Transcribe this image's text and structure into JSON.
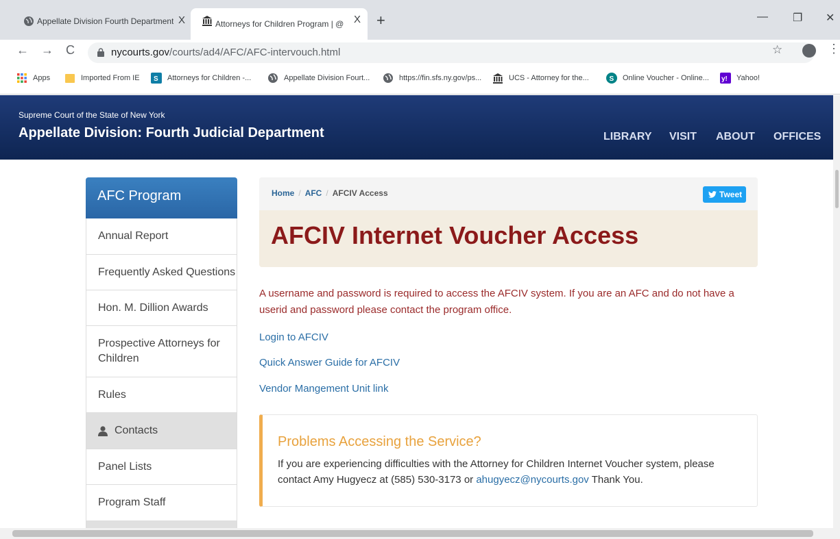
{
  "browser": {
    "tabs": [
      {
        "title": "Appellate Division Fourth Department",
        "close": "X"
      },
      {
        "title": "Attorneys for Children Program | @NYA",
        "close": "X"
      }
    ],
    "new_tab": "+",
    "window": {
      "minimize": "—",
      "maximize": "❐",
      "close": "✕"
    },
    "nav": {
      "back": "←",
      "forward": "→",
      "reload": "C"
    },
    "url_host": "nycourts.gov",
    "url_path": "/courts/ad4/AFC/AFC-intervouch.html",
    "star": "☆",
    "menu": "⋮",
    "bookmarks": [
      {
        "label": "Apps",
        "icon": "apps-grid-icon"
      },
      {
        "label": "Imported From IE",
        "icon": "folder-icon"
      },
      {
        "label": "Attorneys for Children -...",
        "icon": "sharepoint-icon"
      },
      {
        "label": "Appellate Division Fourt...",
        "icon": "globe-icon"
      },
      {
        "label": "https://fin.sfs.ny.gov/ps...",
        "icon": "globe-icon"
      },
      {
        "label": "UCS - Attorney for the...",
        "icon": "courthouse-icon"
      },
      {
        "label": "Online Voucher - Online...",
        "icon": "sharepoint-icon"
      },
      {
        "label": "Yahoo!",
        "icon": "yahoo-icon"
      }
    ]
  },
  "header": {
    "court": "Supreme Court of the State of New York",
    "department": "Appellate Division: Fourth Judicial Department",
    "nav": [
      "LIBRARY",
      "VISIT",
      "ABOUT",
      "OFFICES"
    ]
  },
  "sidebar": {
    "title": "AFC Program",
    "items": [
      {
        "label": "Annual Report"
      },
      {
        "label": "Frequently Asked Questions"
      },
      {
        "label": "Hon. M. Dillion Awards"
      },
      {
        "label": "Prospective Attorneys for Children"
      },
      {
        "label": "Rules"
      },
      {
        "label": "Contacts"
      },
      {
        "label": "Panel Lists"
      },
      {
        "label": "Program Staff"
      }
    ]
  },
  "breadcrumb": {
    "home": "Home",
    "afc": "AFC",
    "current": "AFCIV Access",
    "sep": "/"
  },
  "tweet": "Tweet",
  "page_title": "AFCIV Internet Voucher Access",
  "intro": "A username and password is required to access the AFCIV system. If you are an AFC and do not have a userid and password please contact the program office.",
  "links": [
    "Login to AFCIV",
    "Quick Answer Guide for AFCIV",
    "Vendor Mangement Unit link"
  ],
  "alert": {
    "title": "Problems Accessing the Service?",
    "body_before": "If you are experiencing difficulties with the Attorney for Children Internet Voucher system, please contact Amy Hugyecz at (585) 530-3173 or ",
    "email": "ahugyecz@nycourts.gov",
    "body_after": " Thank You."
  },
  "colors": {
    "header": "#1f3b78",
    "sidebar_head": "#2a66a6",
    "title": "#8b1a1a",
    "link": "#2a6ea6",
    "alert_accent": "#f0ad4e"
  }
}
